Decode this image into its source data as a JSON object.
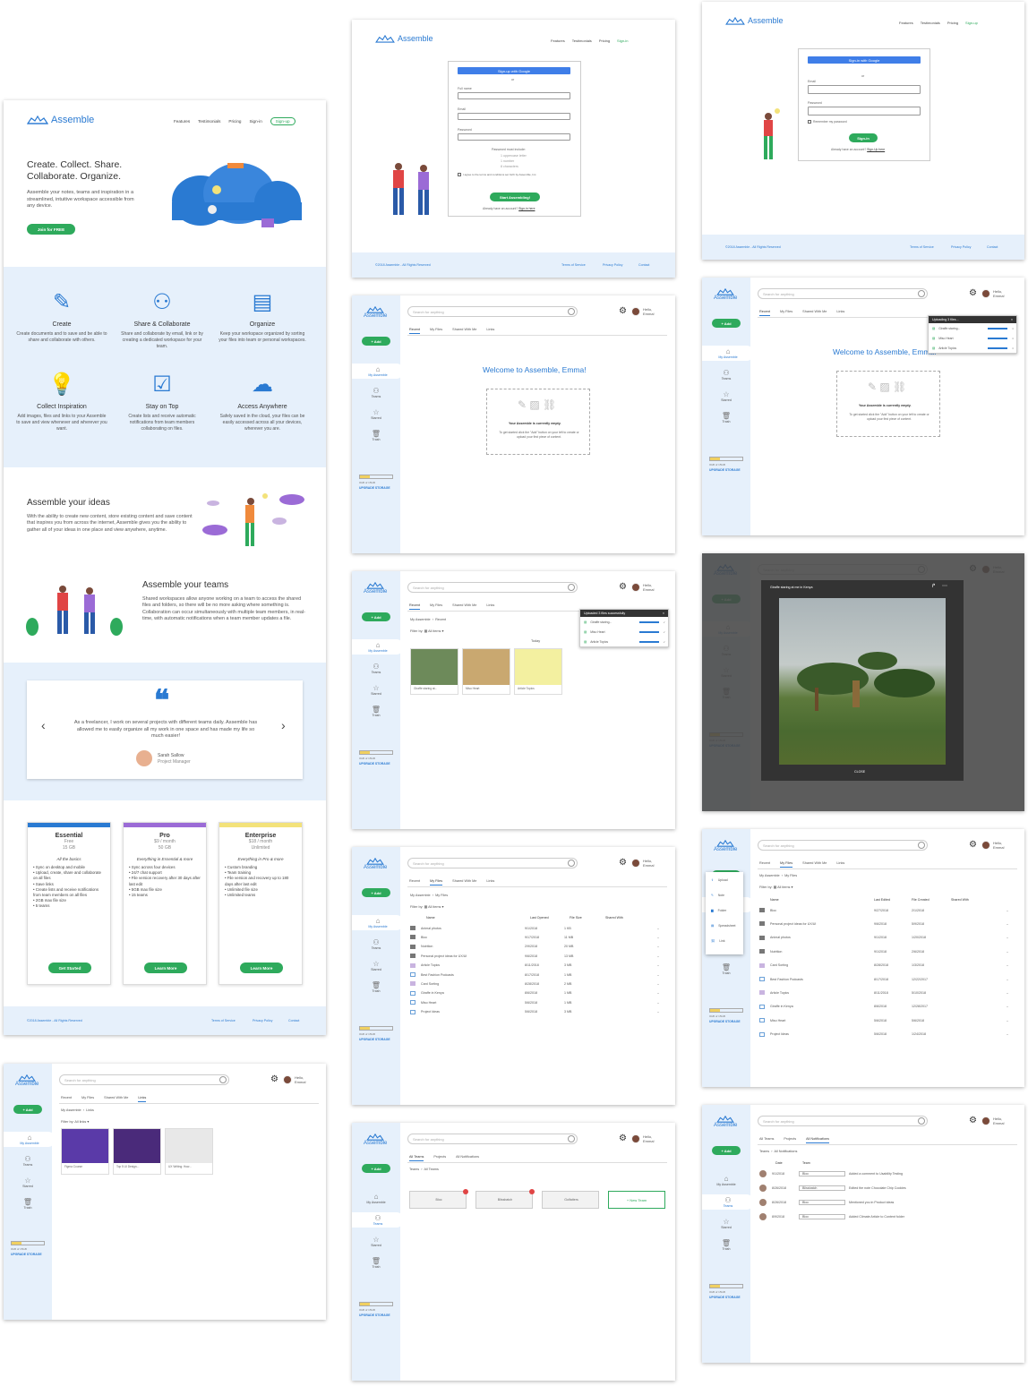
{
  "brand": "Assemble",
  "colors": {
    "accent": "#2a7ad2",
    "green": "#2eaa5c",
    "sidebar": "#e6f0fb",
    "essential": "#2a7ad2",
    "pro": "#9b6bd6",
    "enterprise": "#f3e27a"
  },
  "nav": {
    "features": "Features",
    "testimonials": "Testimonials",
    "pricing": "Pricing",
    "signin": "Sign-in",
    "signup": "Sign-up"
  },
  "landing": {
    "hero_title_1": "Create. Collect. Share.",
    "hero_title_2": "Collaborate. Organize.",
    "hero_text": "Assemble your notes, teams and inspiration in a streamlined, intuitive workspace accessible from any device.",
    "join": "Join for FREE",
    "features": [
      {
        "title": "Create",
        "icon": "pencil-icon",
        "text": "Create documents and to save and be able to share and collaborate with others."
      },
      {
        "title": "Share & Collaborate",
        "icon": "people-icon",
        "text": "Share and collaborate by email, link or by creating a dedicated workspace for your team."
      },
      {
        "title": "Organize",
        "icon": "folders-icon",
        "text": "Keep your workspace organized by sorting your files into team or personal workspaces."
      },
      {
        "title": "Collect Inspiration",
        "icon": "lightbulb-icon",
        "text": "Add images, files and links to your Assemble to save and view whenever and wherever you want."
      },
      {
        "title": "Stay on Top",
        "icon": "checklist-icon",
        "text": "Create lists and receive automatic notifications from team members collaborating on files."
      },
      {
        "title": "Access Anywhere",
        "icon": "cloud-lock-icon",
        "text": "Safely saved in the cloud, your files can be easily accessed across all your devices, wherever you are."
      }
    ],
    "ideas_title": "Assemble your ideas",
    "ideas_text": "With the ability to create new content, store existing content and save content that inspires you from across the internet, Assemble gives you the ability to gather all of your ideas in one place and view anywhere, anytime.",
    "teams_title": "Assemble your teams",
    "teams_text": "Shared workspaces allow anyone working on a team to access the shared files and folders, so there will be no more asking where something is. Collaboration can occur simultaneously with multiple team members, in real-time, with automatic notifications when a team member updates a file.",
    "quote": "As a freelancer, I work on several projects with different teams daily. Assemble has allowed me to easily organize all my work in one space and has made my life so much easier!",
    "quote_name": "Sarah Sallow",
    "quote_role": "Project Manager",
    "plans": [
      {
        "name": "Essential",
        "price": "Free",
        "storage": "15 GB",
        "tag": "All the basics",
        "items": [
          "Sync on desktop and mobile",
          "Upload, create, share and collaborate on all files",
          "Save links",
          "Create lists and receive notifications from team members on all files",
          "2GB max file size",
          "5 teams"
        ],
        "cta": "Get Started"
      },
      {
        "name": "Pro",
        "price": "$9 / month",
        "storage": "50 GB",
        "tag": "Everything in Essential & more",
        "items": [
          "Sync across four devices",
          "24/7 chat support",
          "File version recovery after 30 days after last edit",
          "5GB max file size",
          "15 teams"
        ],
        "cta": "Learn More"
      },
      {
        "name": "Enterprise",
        "price": "$18 / month",
        "storage": "Unlimited",
        "tag": "Everything in Pro & more",
        "items": [
          "Custom branding",
          "Team training",
          "File version and recovery up to 180 days after last edit",
          "Unlimited file size",
          "Unlimited teams"
        ],
        "cta": "Learn More"
      }
    ]
  },
  "footer": {
    "copy": "©2018 Assemble - All Rights Reserved",
    "terms": "Terms of Service",
    "privacy": "Privacy Policy",
    "contact": "Contact"
  },
  "signup": {
    "google": "Sign-up with Google",
    "or": "or",
    "full_name": "Full name",
    "email": "Email",
    "password": "Password",
    "rules_title": "Password must include:",
    "rules": [
      "1 uppercase letter",
      "1 number",
      "8 characters"
    ],
    "terms": "I agree to the terms and conditions set forth by Assemble, Inc.",
    "cta": "Start Assembling!",
    "have_account": "Already have an account?",
    "signin_link": "Sign-in here"
  },
  "signin": {
    "google": "Sign-in with Google",
    "or": "or",
    "email": "Email",
    "password": "Password",
    "remember": "Remember my password",
    "cta": "Sign-in",
    "no_account": "Already have an account?",
    "signup_link": "Sign-Up here"
  },
  "app": {
    "search_placeholder": "Search for anything",
    "hello": "Hello,",
    "user": "Emma!",
    "add": "+ Add",
    "side": [
      "My Assemble",
      "Teams",
      "Starred",
      "Trash"
    ],
    "storage": "0GB of 15GB",
    "upgrade": "UPGRADE STORAGE",
    "tabs": [
      "Recent",
      "My Files",
      "Shared With Me",
      "Links"
    ],
    "welcome": "Welcome to Assemble, Emma!",
    "empty_title": "Your Assemble is currently empty.",
    "empty_text": "To get started click the \"Add\" button on your left to create or upload your first piece of content.",
    "uploading": "Uploading 3 files...",
    "uploaded": "Uploaded 3 files successfully",
    "upload_files": [
      "Giraffe staring...",
      "Miso Heart",
      "Article Topics"
    ],
    "crumb_recent": [
      "My Assemble",
      "Recent"
    ],
    "filter": "Filter by:",
    "all_items": "All items",
    "today": "Today",
    "thumbs": [
      "Giraffe staring at...",
      "Miso Heart",
      "Article Topics"
    ],
    "modal_title": "Giraffe staring at me in Kenya",
    "close": "CLOSE",
    "crumb_files": [
      "My Assemble",
      "My Files"
    ],
    "cols": [
      "Name",
      "Last Opened",
      "File Size",
      "Shared With"
    ],
    "files": [
      {
        "n": "Animal photos",
        "d": "9/1/2018",
        "s": "1 KB",
        "t": "f"
      },
      {
        "n": "Bloc",
        "d": "9/17/2018",
        "s": "11 MB",
        "t": "f"
      },
      {
        "n": "Nutrition",
        "d": "2/9/2018",
        "s": "20 MB",
        "t": "f"
      },
      {
        "n": "Personal project ideas for UX/UI",
        "d": "9/6/2018",
        "s": "13 MB",
        "t": "f"
      },
      {
        "n": "Article Topics",
        "d": "8/11/2018",
        "s": "3 MB",
        "t": "p"
      },
      {
        "n": "Best Fashion Podcasts",
        "d": "8/17/2018",
        "s": "1 MB",
        "t": "b"
      },
      {
        "n": "Card Sorting",
        "d": "8/28/2018",
        "s": "2 MB",
        "t": "p"
      },
      {
        "n": "Giraffe in Kenya",
        "d": "8/6/2018",
        "s": "1 MB",
        "t": "b"
      },
      {
        "n": "Miso Heart",
        "d": "5/6/2018",
        "s": "1 MB",
        "t": "b"
      },
      {
        "n": "Project Ideas",
        "d": "5/6/2018",
        "s": "3 MB",
        "t": "b"
      }
    ],
    "cols2": [
      "Name",
      "Last Edited",
      "File Created",
      "Shared With"
    ],
    "files2": [
      {
        "n": "Bloc",
        "a": "9/27/2018",
        "b": "2/1/2018",
        "t": "f"
      },
      {
        "n": "Personal project ideas for UX/UI",
        "a": "9/6/2018",
        "b": "5/9/2018",
        "t": "f"
      },
      {
        "n": "Animal photos",
        "a": "9/1/2018",
        "b": "1/20/2018",
        "t": "f"
      },
      {
        "n": "Nutrition",
        "a": "9/1/2018",
        "b": "2/6/2018",
        "t": "f"
      },
      {
        "n": "Card Sorting",
        "a": "8/28/2018",
        "b": "1/3/2018",
        "t": "p"
      },
      {
        "n": "Best Fashion Podcasts",
        "a": "8/17/2018",
        "b": "12/22/2017",
        "t": "b"
      },
      {
        "n": "Article Topics",
        "a": "8/11/2018",
        "b": "5/10/2018",
        "t": "p"
      },
      {
        "n": "Giraffe in Kenya",
        "a": "8/6/2018",
        "b": "12/28/2017",
        "t": "b"
      },
      {
        "n": "Miso Heart",
        "a": "5/6/2018",
        "b": "5/6/2018",
        "t": "b"
      },
      {
        "n": "Project Ideas",
        "a": "5/6/2018",
        "b": "1/24/2018",
        "t": "b"
      }
    ],
    "add_menu": [
      "Upload",
      "Note",
      "Folder",
      "Spreadsheet",
      "Link"
    ],
    "crumb_links": [
      "My Assemble",
      "Links"
    ],
    "all_links": "All links",
    "links": [
      "Figma Course",
      "Top 5 UI Design...",
      "UX Writing: How..."
    ],
    "team_tabs": [
      "All Teams",
      "Projects",
      "All Notifications"
    ],
    "crumb_teams": [
      "Teams",
      "All Teams"
    ],
    "teams": [
      "Bloc",
      "Blissbatch",
      "Golfatters"
    ],
    "new_team": "+ New Team",
    "crumb_notif": [
      "Teams",
      "All Notifications"
    ],
    "notif_cols": [
      "Date",
      "Team"
    ],
    "notifs": [
      {
        "d": "9/1/2018",
        "t": "Bloc",
        "m": "Added a comment to Usability Testing"
      },
      {
        "d": "8/26/2018",
        "t": "Blissbatch",
        "m": "Edited the note Chocolate Chip Cookies"
      },
      {
        "d": "8/26/2018",
        "t": "Bloc",
        "m": "Mentioned you in Product ideas"
      },
      {
        "d": "8/9/2018",
        "t": "Bloc",
        "m": "Added Climate Article to Content folder"
      }
    ]
  }
}
